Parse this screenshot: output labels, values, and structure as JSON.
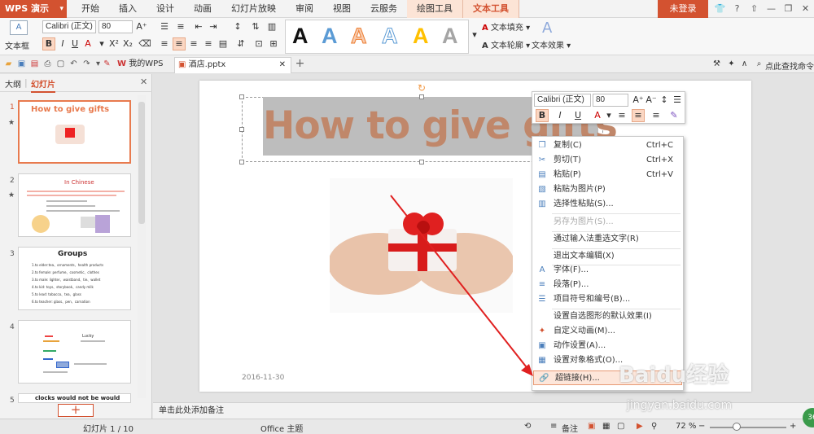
{
  "app": {
    "name": "WPS 演示",
    "login": "未登录"
  },
  "ribbon_tabs": [
    "开始",
    "插入",
    "设计",
    "动画",
    "幻灯片放映",
    "审阅",
    "视图",
    "云服务",
    "绘图工具",
    "文本工具"
  ],
  "ribbon": {
    "textbox_label": "文本框",
    "font_name": "Calibri (正文)",
    "font_size": "80",
    "fill_label": "文本填充",
    "outline_label": "文本轮廓",
    "effect_label": "文本效果",
    "style_glyph": "A"
  },
  "doc_tabs": {
    "mywps": "我的WPS",
    "file": "酒店.pptx",
    "search": "点此查找命令"
  },
  "left_panel": {
    "tab_outline": "大纲",
    "tab_slides": "幻灯片",
    "slides": [
      {
        "num": "1",
        "title": "How to give gifts"
      },
      {
        "num": "2",
        "title": "In Chinese"
      },
      {
        "num": "3",
        "title": "Groups"
      },
      {
        "num": "4",
        "title": "Lucky"
      },
      {
        "num": "5",
        "title": "clocks would not be would"
      }
    ],
    "slide3_lines": [
      "1.to elder:tea、ornaments、health products",
      "2.to female: perfume、cosmetic、clothes",
      "3.to male: lighter、waistband、tie、wallet",
      "4.to kid: toys、storybook、candy milk",
      "5.to lead: tobacco、tea、glass",
      "6.to teacher: glass、pen、carnation"
    ]
  },
  "slide": {
    "title": "How to give gifts",
    "date": "2016-11-30"
  },
  "mini_toolbar": {
    "font_name": "Calibri (正文)",
    "font_size": "80"
  },
  "context_menu": [
    {
      "label": "复制(C)",
      "shortcut": "Ctrl+C",
      "icon": "copy-icon"
    },
    {
      "label": "剪切(T)",
      "shortcut": "Ctrl+X",
      "icon": "cut-icon"
    },
    {
      "label": "粘贴(P)",
      "shortcut": "Ctrl+V",
      "icon": "paste-icon"
    },
    {
      "label": "粘贴为图片(P)",
      "shortcut": "",
      "icon": "paste-image-icon"
    },
    {
      "label": "选择性粘贴(S)...",
      "shortcut": "",
      "icon": "paste-special-icon"
    },
    {
      "label": "另存为图片(S)...",
      "shortcut": "",
      "icon": ""
    },
    {
      "label": "通过输入法重选文字(R)",
      "shortcut": "",
      "icon": ""
    },
    {
      "label": "退出文本编辑(X)",
      "shortcut": "",
      "icon": ""
    },
    {
      "label": "字体(F)...",
      "shortcut": "",
      "icon": "font-icon"
    },
    {
      "label": "段落(P)...",
      "shortcut": "",
      "icon": "paragraph-icon"
    },
    {
      "label": "项目符号和编号(B)...",
      "shortcut": "",
      "icon": "bullets-icon"
    },
    {
      "label": "设置自选图形的默认效果(I)",
      "shortcut": "",
      "icon": ""
    },
    {
      "label": "自定义动画(M)...",
      "shortcut": "",
      "icon": "animation-icon"
    },
    {
      "label": "动作设置(A)...",
      "shortcut": "",
      "icon": "action-icon"
    },
    {
      "label": "设置对象格式(O)...",
      "shortcut": "",
      "icon": "format-icon"
    },
    {
      "label": "超链接(H)...",
      "shortcut": "",
      "icon": "hyperlink-icon"
    }
  ],
  "notes_placeholder": "单击此处添加备注",
  "status": {
    "slide_count": "幻灯片 1 / 10",
    "theme": "Office 主题",
    "notes": "备注",
    "zoom": "72 %"
  },
  "watermark": {
    "brand": "Baidu经验",
    "url": "jingyan.baidu.com"
  },
  "colors": {
    "accent": "#d35230",
    "menu_highlight": "#fde6da",
    "title_text": "#c0876a"
  }
}
